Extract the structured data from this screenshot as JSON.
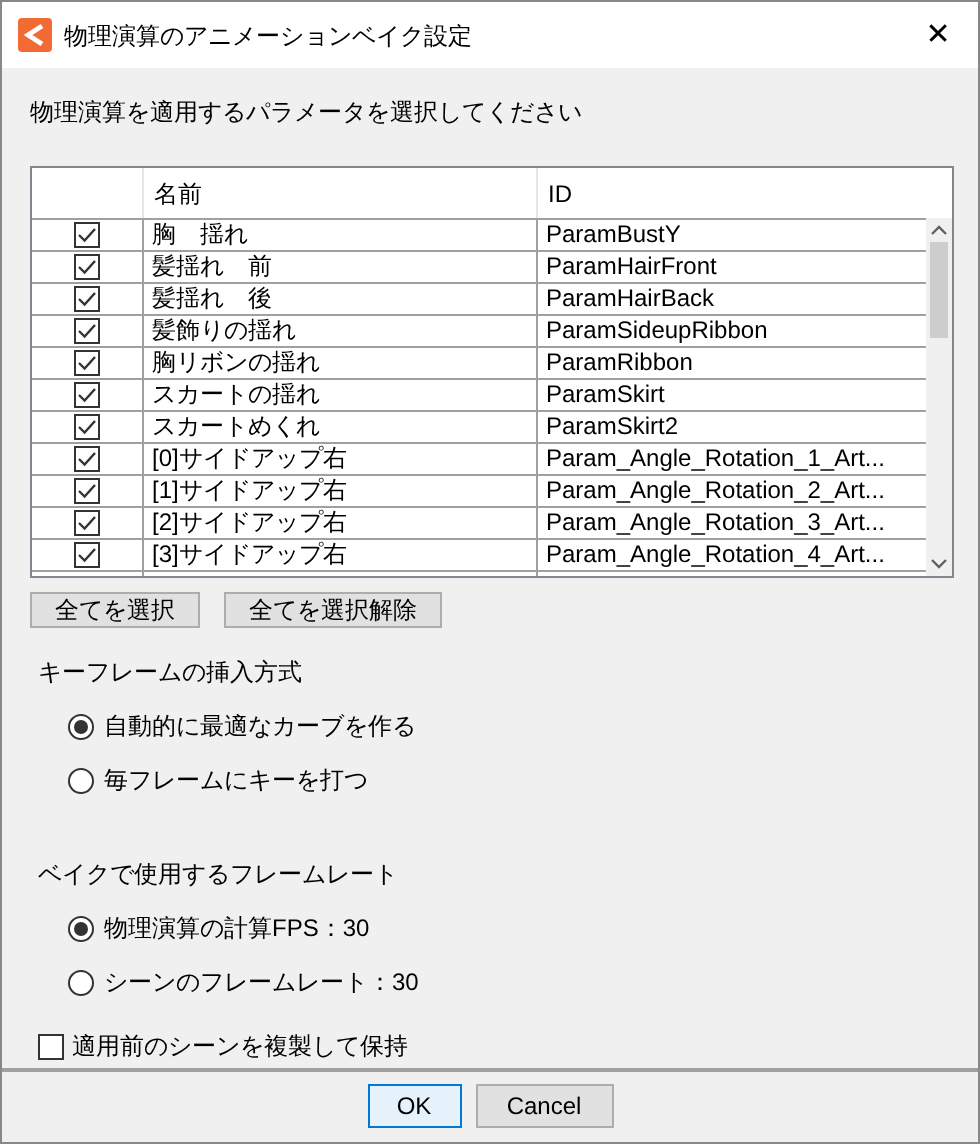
{
  "window": {
    "title": "物理演算のアニメーションベイク設定",
    "close": "✕"
  },
  "instruction": "物理演算を適用するパラメータを選択してください",
  "table": {
    "columns": [
      "名前",
      "ID"
    ],
    "rows": [
      {
        "checked": true,
        "name": "胸　揺れ",
        "id": "ParamBustY"
      },
      {
        "checked": true,
        "name": "髪揺れ　前",
        "id": "ParamHairFront"
      },
      {
        "checked": true,
        "name": "髪揺れ　後",
        "id": "ParamHairBack"
      },
      {
        "checked": true,
        "name": "髪飾りの揺れ",
        "id": "ParamSideupRibbon"
      },
      {
        "checked": true,
        "name": "胸リボンの揺れ",
        "id": "ParamRibbon"
      },
      {
        "checked": true,
        "name": "スカートの揺れ",
        "id": "ParamSkirt"
      },
      {
        "checked": true,
        "name": "スカートめくれ",
        "id": "ParamSkirt2"
      },
      {
        "checked": true,
        "name": "[0]サイドアップ右",
        "id": "Param_Angle_Rotation_1_Art..."
      },
      {
        "checked": true,
        "name": "[1]サイドアップ右",
        "id": "Param_Angle_Rotation_2_Art..."
      },
      {
        "checked": true,
        "name": "[2]サイドアップ右",
        "id": "Param_Angle_Rotation_3_Art..."
      },
      {
        "checked": true,
        "name": "[3]サイドアップ右",
        "id": "Param_Angle_Rotation_4_Art..."
      }
    ]
  },
  "list_buttons": [
    "全てを選択",
    "全てを選択解除"
  ],
  "groups": [
    {
      "label": "キーフレームの挿入方式",
      "options": [
        {
          "label": "自動的に最適なカーブを作る",
          "selected": true
        },
        {
          "label": "毎フレームにキーを打つ",
          "selected": false
        }
      ]
    },
    {
      "label": "ベイクで使用するフレームレート",
      "options": [
        {
          "label": "物理演算の計算FPS：30",
          "selected": true
        },
        {
          "label": "シーンのフレームレート：30",
          "selected": false
        }
      ]
    }
  ],
  "duplicate_option": {
    "label": "適用前のシーンを複製して保持",
    "checked": false
  },
  "footer_buttons": [
    {
      "label": "OK",
      "focused": true
    },
    {
      "label": "Cancel",
      "focused": false
    }
  ]
}
